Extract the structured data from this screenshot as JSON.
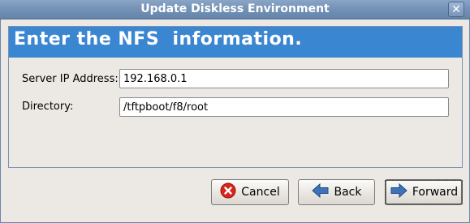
{
  "window": {
    "title": "Update Diskless Environment",
    "close_glyph": "✕"
  },
  "banner": {
    "heading": "Enter the NFS  information."
  },
  "form": {
    "server_ip": {
      "label": "Server IP Address:",
      "value": "192.168.0.1"
    },
    "directory": {
      "label": "Directory:",
      "value": "/tftpboot/f8/root"
    }
  },
  "buttons": {
    "cancel": {
      "label": "Cancel",
      "icon": "cancel-icon"
    },
    "back": {
      "label": "Back",
      "icon": "back-arrow-icon"
    },
    "forward": {
      "label": "Forward",
      "icon": "forward-arrow-icon"
    }
  },
  "colors": {
    "banner": "#3b86d1",
    "titlebar": "#7391b6",
    "cancel_icon": "#d9261c"
  }
}
